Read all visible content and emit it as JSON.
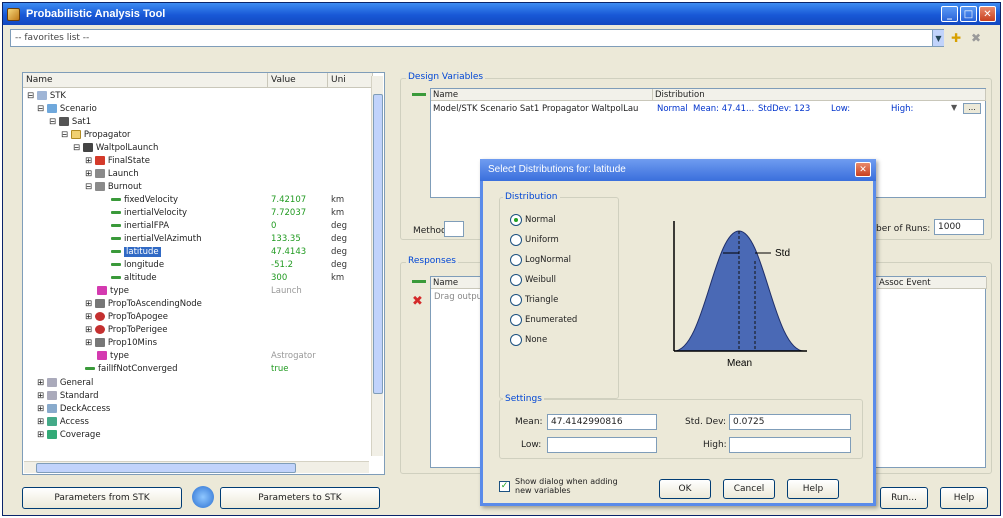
{
  "window": {
    "title": "Probabilistic Analysis Tool"
  },
  "favorites": {
    "value": "-- favorites list --"
  },
  "tree": {
    "columns": [
      "Name",
      "Value",
      "Uni"
    ],
    "rows": [
      {
        "label": "STK",
        "value": "",
        "unit": ""
      },
      {
        "label": "Scenario",
        "value": "",
        "unit": ""
      },
      {
        "label": "Sat1",
        "value": "",
        "unit": ""
      },
      {
        "label": "Propagator",
        "value": "",
        "unit": ""
      },
      {
        "label": "WaltpolLaunch",
        "value": "",
        "unit": ""
      },
      {
        "label": "FinalState",
        "value": "",
        "unit": ""
      },
      {
        "label": "Launch",
        "value": "",
        "unit": ""
      },
      {
        "label": "Burnout",
        "value": "",
        "unit": ""
      },
      {
        "label": "fixedVelocity",
        "value": "7.42107",
        "unit": "km"
      },
      {
        "label": "inertialVelocity",
        "value": "7.72037",
        "unit": "km"
      },
      {
        "label": "inertialFPA",
        "value": "0",
        "unit": "deg"
      },
      {
        "label": "inertialVelAzimuth",
        "value": "133.35",
        "unit": "deg"
      },
      {
        "label": "latitude",
        "value": "47.4143",
        "unit": "deg"
      },
      {
        "label": "longitude",
        "value": "-51.2",
        "unit": "deg"
      },
      {
        "label": "altitude",
        "value": "300",
        "unit": "km"
      },
      {
        "label": "type",
        "value": "Launch",
        "unit": ""
      },
      {
        "label": "PropToAscendingNode",
        "value": "",
        "unit": ""
      },
      {
        "label": "PropToApogee",
        "value": "",
        "unit": ""
      },
      {
        "label": "PropToPerigee",
        "value": "",
        "unit": ""
      },
      {
        "label": "Prop10Mins",
        "value": "",
        "unit": ""
      },
      {
        "label": "type",
        "value": "Astrogator",
        "unit": ""
      },
      {
        "label": "failIfNotConverged",
        "value": "true",
        "unit": ""
      },
      {
        "label": "General",
        "value": "",
        "unit": ""
      },
      {
        "label": "Standard",
        "value": "",
        "unit": ""
      },
      {
        "label": "DeckAccess",
        "value": "",
        "unit": ""
      },
      {
        "label": "Access",
        "value": "",
        "unit": ""
      },
      {
        "label": "Coverage",
        "value": "",
        "unit": ""
      }
    ]
  },
  "buttons": {
    "from_stk": "Parameters from STK",
    "to_stk": "Parameters to STK",
    "run": "Run...",
    "help": "Help"
  },
  "design_variables": {
    "label": "Design Variables",
    "columns": [
      "Name",
      "Distribution"
    ],
    "row": {
      "name": "Model/STK Scenario Sat1 Propagator WaltpolLau",
      "dist": "Normal",
      "mean": "Mean: 47.41...",
      "stddev": "StdDev: 123",
      "low": "Low:",
      "high": "High:"
    },
    "method_label": "Method:",
    "runs_label": "ber of Runs:",
    "runs_value": "1000"
  },
  "responses": {
    "label": "Responses",
    "name_col": "Name",
    "assoc_col": "Assoc Event",
    "placeholder": "Drag output"
  },
  "dialog": {
    "title": "Select Distributions for: latitude",
    "distribution_label": "Distribution",
    "options": [
      "Normal",
      "Uniform",
      "LogNormal",
      "Weibull",
      "Triangle",
      "Enumerated",
      "None"
    ],
    "selected": "Normal",
    "chart_std_label": "Std",
    "chart_mean_label": "Mean",
    "settings_label": "Settings",
    "mean_label": "Mean:",
    "mean_value": "47.4142990816",
    "stddev_label": "Std. Dev:",
    "stddev_value": "0.0725",
    "low_label": "Low:",
    "high_label": "High:",
    "show_dialog_label": "Show dialog when adding new variables",
    "ok": "OK",
    "cancel": "Cancel",
    "help": "Help"
  }
}
